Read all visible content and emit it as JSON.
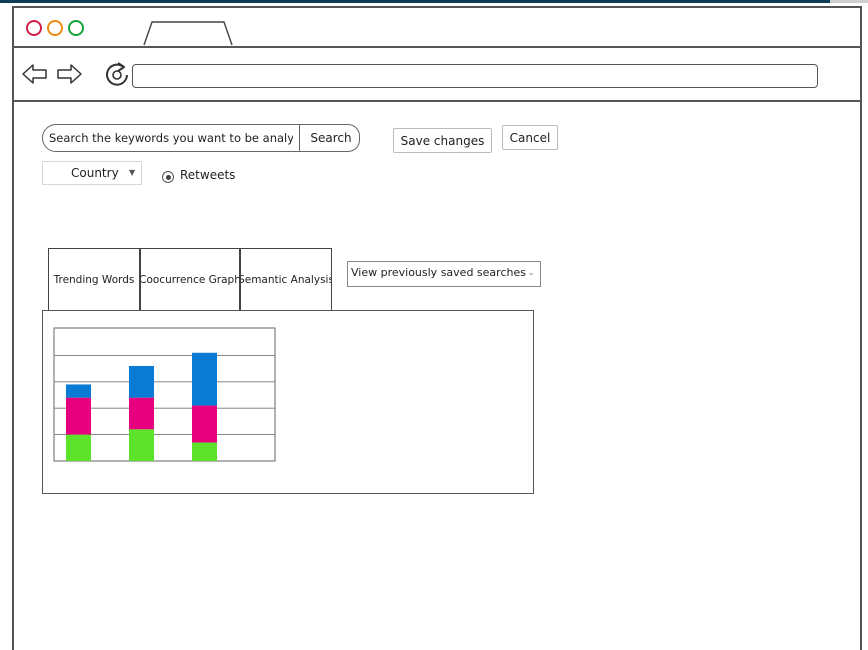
{
  "browser": {
    "address_bar": {
      "value": ""
    },
    "nav": {
      "back_icon": "left-arrow-icon",
      "forward_icon": "right-arrow-icon",
      "reload_icon": "reload-icon"
    },
    "traffic_lights": {
      "close": "#d01e4b",
      "minimize": "#f08c12",
      "maximize": "#15a23a"
    }
  },
  "toolbar": {
    "search_placeholder": "Search the keywords you want to be analyzed.",
    "search_button": "Search",
    "save_button": "Save changes",
    "cancel_button": "Cancel"
  },
  "filters": {
    "country_select": "Country",
    "retweets_label": "Retweets",
    "retweets_selected": true
  },
  "tabs": [
    {
      "label": "Trending Words"
    },
    {
      "label": "Coocurrence Graph"
    },
    {
      "label": "Semantic Analysis"
    }
  ],
  "saved_searches": {
    "selected": "View previously saved searches"
  },
  "chart_data": {
    "type": "bar",
    "stacked": true,
    "categories": [
      "",
      "",
      ""
    ],
    "series": [
      {
        "color": "#5ee32c",
        "values": [
          1,
          1.2,
          0.7
        ]
      },
      {
        "color": "#e6007e",
        "values": [
          1.4,
          1.2,
          1.4
        ]
      },
      {
        "color": "#0a7bd4",
        "values": [
          0.5,
          1.2,
          2.0
        ]
      }
    ],
    "ylim": [
      0,
      5
    ],
    "grid": true,
    "title": "",
    "xlabel": "",
    "ylabel": ""
  }
}
